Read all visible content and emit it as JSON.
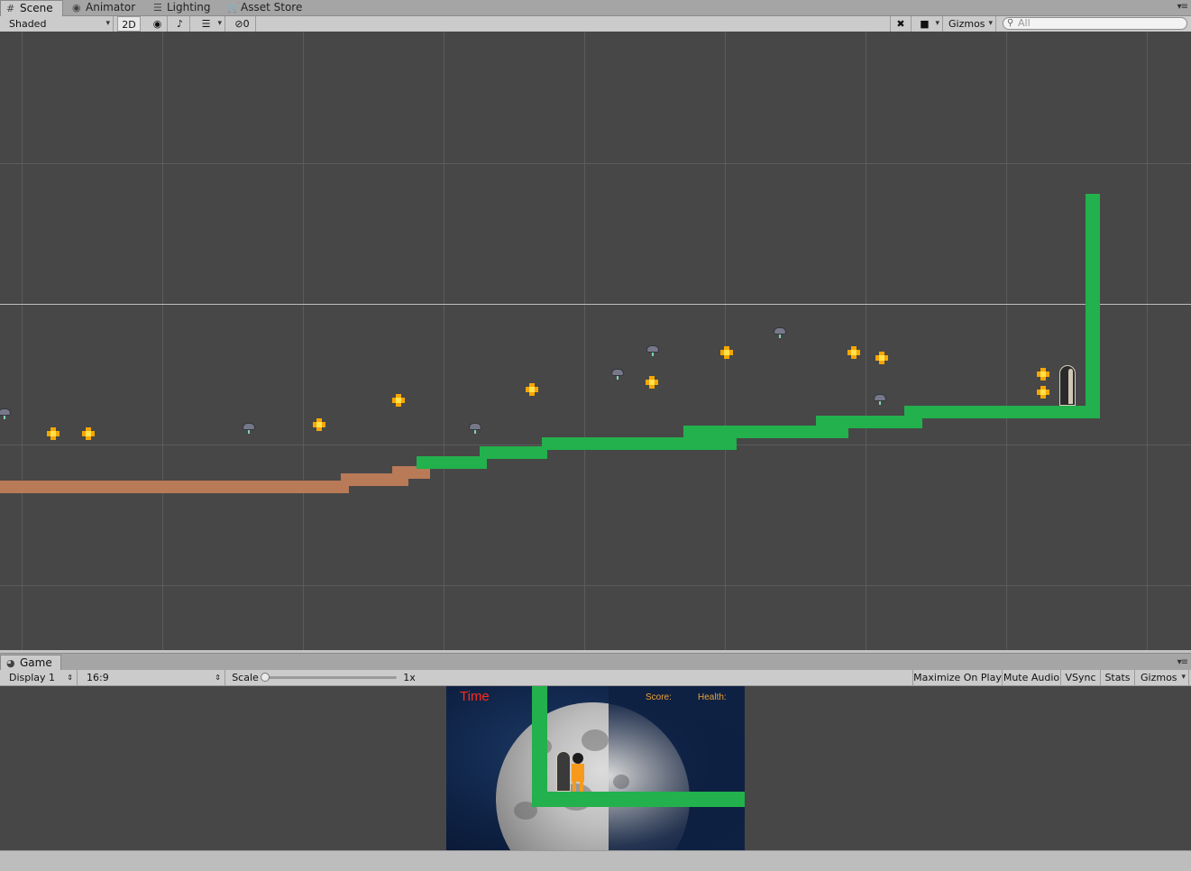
{
  "scene_tabs": [
    {
      "label": "Scene",
      "icon": "grid-icon"
    },
    {
      "label": "Animator",
      "icon": "animator-icon"
    },
    {
      "label": "Lighting",
      "icon": "lighting-icon"
    },
    {
      "label": "Asset Store",
      "icon": "asset-store-icon"
    }
  ],
  "scene_toolbar": {
    "draw_mode": "Shaded",
    "mode_2d": "2D",
    "hidden_count": "0",
    "gizmos": "Gizmos",
    "search_placeholder": "All"
  },
  "game_tab": {
    "label": "Game",
    "icon": "game-icon"
  },
  "game_toolbar": {
    "display": "Display 1",
    "aspect": "16:9",
    "scale_label": "Scale",
    "scale_value": "1x",
    "scale_level": 0,
    "maximize": "Maximize On Play",
    "mute": "Mute Audio",
    "vsync": "VSync",
    "stats": "Stats",
    "gizmos": "Gizmos"
  },
  "game_hud": {
    "time": "Time",
    "score": "Score:",
    "health": "Health:"
  },
  "colors": {
    "platform": "#22b14c",
    "dirt": "#b97a57",
    "coin": "#f7a600",
    "scene_bg": "#474747",
    "time_text": "#ff2a1a",
    "hud_text": "#f0a030"
  }
}
